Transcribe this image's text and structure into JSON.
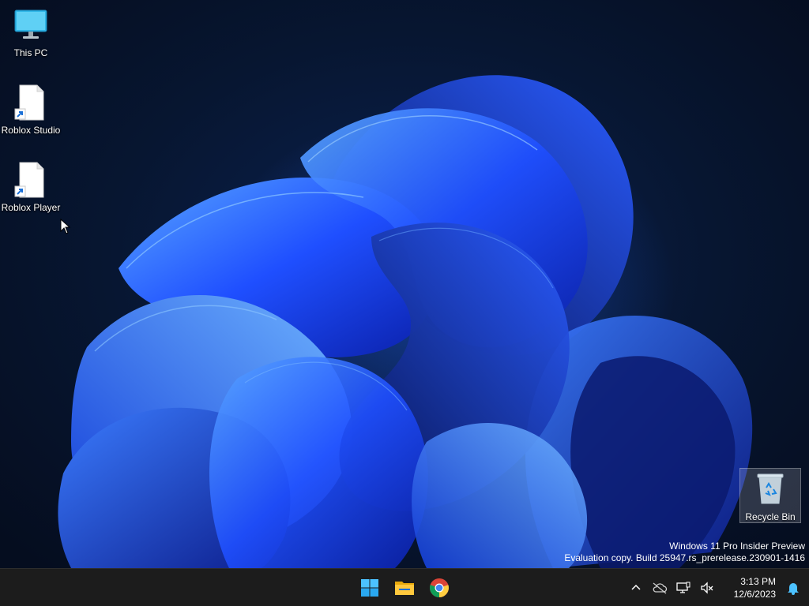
{
  "desktop": {
    "icons": [
      {
        "label": "This PC",
        "icon": "monitor-icon"
      },
      {
        "label": "Roblox Studio",
        "icon": "file-shortcut-icon"
      },
      {
        "label": "Roblox Player",
        "icon": "file-shortcut-icon"
      }
    ],
    "recycle_bin": {
      "label": "Recycle Bin",
      "icon": "recycle-bin-icon"
    },
    "watermark": {
      "line1": "Windows 11 Pro Insider Preview",
      "line2": "Evaluation copy. Build 25947.rs_prerelease.230901-1416"
    }
  },
  "taskbar": {
    "apps": [
      {
        "name": "Start",
        "icon": "windows-start-icon"
      },
      {
        "name": "File Explorer",
        "icon": "folder-icon"
      },
      {
        "name": "Google Chrome",
        "icon": "chrome-icon"
      }
    ],
    "tray": {
      "icons": [
        "chevron-up-icon",
        "cloud-offline-icon",
        "network-icon",
        "volume-muted-icon"
      ],
      "time": "3:13 PM",
      "date": "12/6/2023",
      "notification_icon": "bell-icon"
    }
  },
  "colors": {
    "accent": "#0078d4",
    "taskbar_bg": "#1c1c1c",
    "bloom_blue": "#1f4fff"
  }
}
